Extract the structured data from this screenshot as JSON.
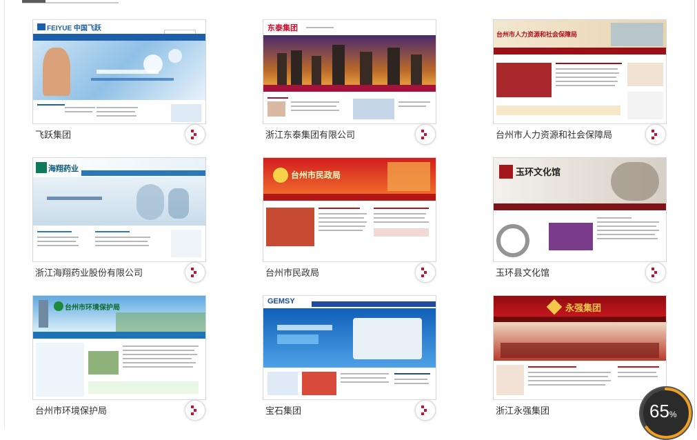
{
  "cards": [
    {
      "title": "飞跃集团",
      "logo_text": "FEIYUE 中国飞跃"
    },
    {
      "title": "浙江东泰集团有限公司",
      "logo_text": "东泰集团"
    },
    {
      "title": "台州市人力资源和社会保障局",
      "logo_text": "台州市人力资源和社会保障局"
    },
    {
      "title": "浙江海翔药业股份有限公司",
      "logo_text": "海翔药业"
    },
    {
      "title": "台州市民政局",
      "logo_text": "台州市民政局"
    },
    {
      "title": "玉环县文化馆",
      "logo_text": "玉环文化馆"
    },
    {
      "title": "台州市环境保护局",
      "logo_text": "台州市环境保护局"
    },
    {
      "title": "宝石集团",
      "logo_text": "GEMSY"
    },
    {
      "title": "浙江永强集团",
      "logo_text": "永强集团"
    }
  ],
  "progress": {
    "value": "65",
    "unit": "%",
    "fraction": 0.65
  },
  "colors": {
    "accent": "#c8102e",
    "card_border": "#d8d8d8",
    "title_text": "#333333"
  },
  "icons": {
    "more": "arrow-right-icon"
  }
}
